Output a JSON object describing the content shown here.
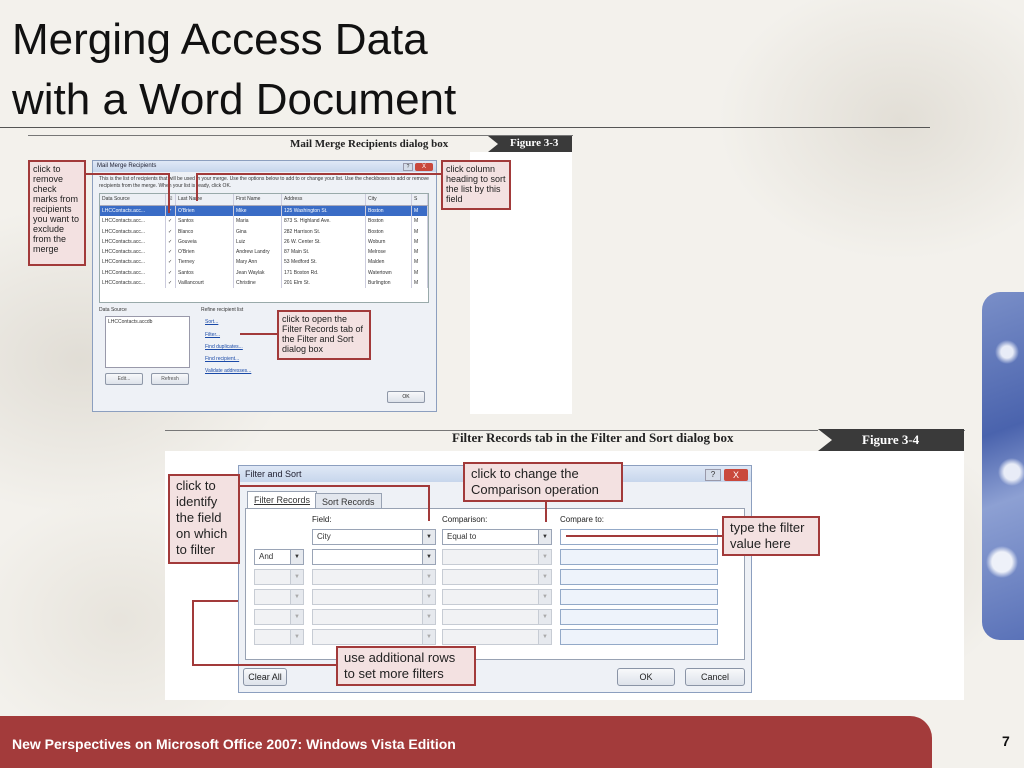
{
  "slide": {
    "title_line1": "Merging Access Data",
    "title_line2": "with a Word Document",
    "footer": "New Perspectives on Microsoft Office 2007: Windows Vista Edition",
    "page_number": "7"
  },
  "figure1": {
    "caption": "Mail Merge Recipients dialog box",
    "tag": "Figure  3-3",
    "dialog": {
      "title": "Mail Merge Recipients",
      "help": "?",
      "close": "X",
      "description": "This is the list of recipients that will be used in your merge. Use the options below to add to or change your list. Use the checkboxes to add or remove recipients from the merge. When your list is ready, click OK.",
      "columns": [
        "Data Source",
        "",
        "Last Name",
        "First Name",
        "Address",
        "City",
        "S"
      ],
      "rows": [
        [
          "LHCContacts.acc...",
          "✓",
          "O'Brien",
          "Mike",
          "125 Washington St.",
          "Boston",
          "M"
        ],
        [
          "LHCContacts.acc...",
          "✓",
          "Santos",
          "Maria",
          "873 S. Highland Ave.",
          "Boston",
          "M"
        ],
        [
          "LHCContacts.acc...",
          "✓",
          "Blanco",
          "Gina",
          "282 Harrison St.",
          "Boston",
          "M"
        ],
        [
          "LHCContacts.acc...",
          "✓",
          "Gouveia",
          "Luiz",
          "26 W. Center St.",
          "Woburn",
          "M"
        ],
        [
          "LHCContacts.acc...",
          "✓",
          "O'Brien",
          "Andrew Landry",
          "87 Main St.",
          "Melrose",
          "M"
        ],
        [
          "LHCContacts.acc...",
          "✓",
          "Tierney",
          "Mary Ann",
          "53 Medford St.",
          "Malden",
          "M"
        ],
        [
          "LHCContacts.acc...",
          "✓",
          "Santos",
          "Jean Waylak",
          "171 Boston Rd.",
          "Watertown",
          "M"
        ],
        [
          "LHCContacts.acc...",
          "✓",
          "Vaillancourt",
          "Christine",
          "201 Elm St.",
          "Burlington",
          "M"
        ]
      ],
      "data_source_label": "Data Source",
      "data_source_item": "LHCContacts.accdb",
      "refine_label": "Refine recipient list",
      "links": [
        "Sort...",
        "Filter...",
        "Find duplicates...",
        "Find recipient...",
        "Validate addresses..."
      ],
      "edit_button": "Edit...",
      "refresh_button": "Refresh",
      "ok_button": "OK"
    },
    "callouts": {
      "checkmarks": "click to remove check marks from recipients you want to exclude from the merge",
      "column_heading": "click column heading to sort the list by this field",
      "filter": "click to open the Filter Records tab of the Filter and Sort dialog box"
    }
  },
  "figure2": {
    "caption": "Filter Records tab in the Filter and Sort dialog box",
    "tag": "Figure  3-4",
    "dialog": {
      "title": "Filter and Sort",
      "help": "?",
      "close": "X",
      "tab_filter": "Filter Records",
      "tab_sort": "Sort Records",
      "field_label": "Field:",
      "comparison_label": "Comparison:",
      "compare_to_label": "Compare to:",
      "field_value": "City",
      "comparison_value": "Equal to",
      "and_value": "And",
      "clear_all": "Clear All",
      "ok": "OK",
      "cancel": "Cancel"
    },
    "callouts": {
      "field": "click to identify the field on which to filter",
      "comparison": "click to change the Comparison operation",
      "value": "type the filter value here",
      "rows": "use additional rows to set more filters"
    }
  }
}
